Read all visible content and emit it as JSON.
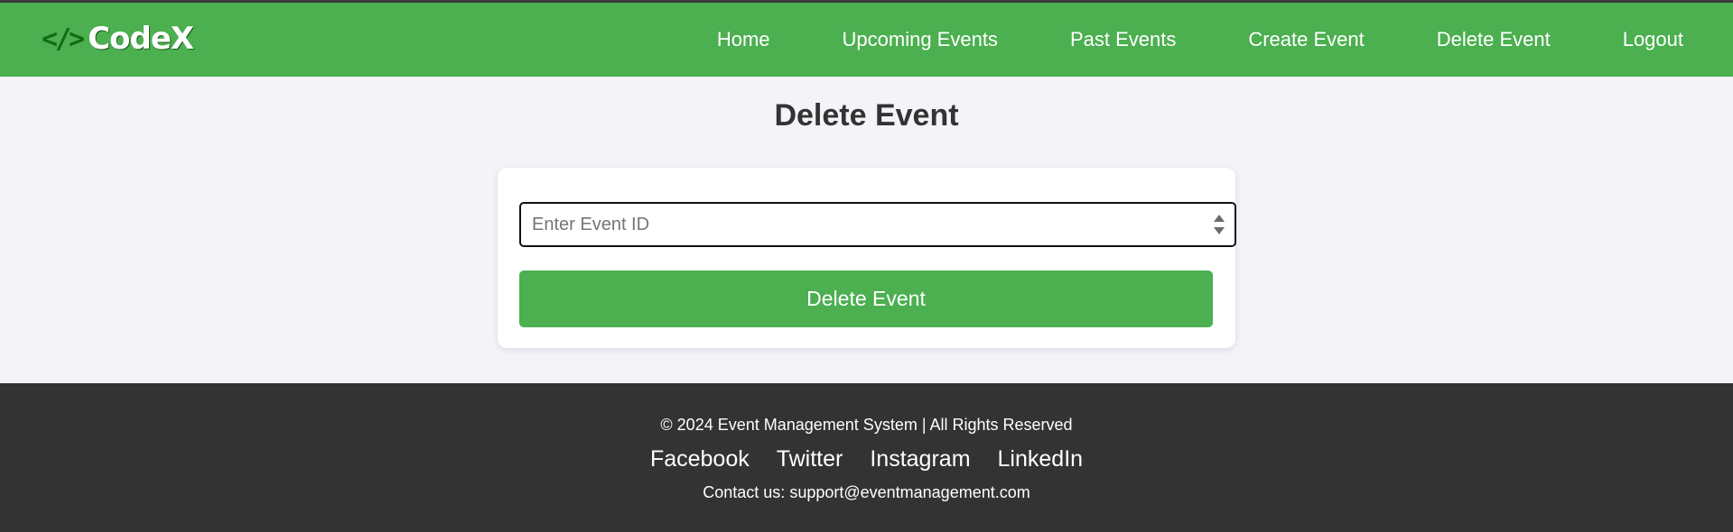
{
  "brand": {
    "icon_text": "</>",
    "name": "CodeX"
  },
  "nav": {
    "items": [
      {
        "label": "Home"
      },
      {
        "label": "Upcoming Events"
      },
      {
        "label": "Past Events"
      },
      {
        "label": "Create Event"
      },
      {
        "label": "Delete Event"
      },
      {
        "label": "Logout"
      }
    ]
  },
  "page": {
    "title": "Delete Event"
  },
  "form": {
    "event_id_placeholder": "Enter Event ID",
    "event_id_value": "",
    "submit_label": "Delete Event"
  },
  "footer": {
    "copyright": "© 2024 Event Management System | All Rights Reserved",
    "socials": [
      {
        "label": "Facebook"
      },
      {
        "label": "Twitter"
      },
      {
        "label": "Instagram"
      },
      {
        "label": "LinkedIn"
      }
    ],
    "contact": "Contact us: support@eventmanagement.com"
  },
  "colors": {
    "primary_green": "#4caf50",
    "footer_bg": "#333333",
    "page_bg": "#f3f3f8",
    "logo_icon": "#146b14"
  }
}
